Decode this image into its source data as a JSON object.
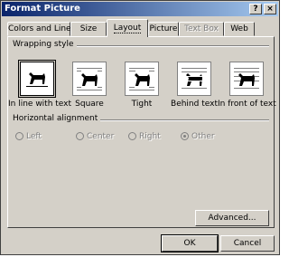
{
  "window": {
    "title": "Format Picture",
    "help_label": "?",
    "close_label": "×"
  },
  "tabs": [
    {
      "label": "Colors and Lines",
      "state": "normal"
    },
    {
      "label": "Size",
      "state": "normal"
    },
    {
      "label": "Layout",
      "state": "active"
    },
    {
      "label": "Picture",
      "state": "normal"
    },
    {
      "label": "Text Box",
      "state": "disabled"
    },
    {
      "label": "Web",
      "state": "normal"
    }
  ],
  "wrapping": {
    "label": "Wrapping style",
    "options": [
      {
        "label": "In line with text",
        "icon": "dog-inline-icon",
        "selected": true
      },
      {
        "label": "Square",
        "icon": "dog-square-icon",
        "selected": false
      },
      {
        "label": "Tight",
        "icon": "dog-tight-icon",
        "selected": false
      },
      {
        "label": "Behind text",
        "icon": "dog-behind-text-icon",
        "selected": false
      },
      {
        "label": "In front of text",
        "icon": "dog-front-text-icon",
        "selected": false
      }
    ]
  },
  "alignment": {
    "label": "Horizontal alignment",
    "options": [
      {
        "label": "Left",
        "checked": false,
        "disabled": true
      },
      {
        "label": "Center",
        "checked": false,
        "disabled": true
      },
      {
        "label": "Right",
        "checked": false,
        "disabled": true
      },
      {
        "label": "Other",
        "checked": true,
        "disabled": true
      }
    ]
  },
  "buttons": {
    "advanced": "Advanced...",
    "ok": "OK",
    "cancel": "Cancel"
  }
}
